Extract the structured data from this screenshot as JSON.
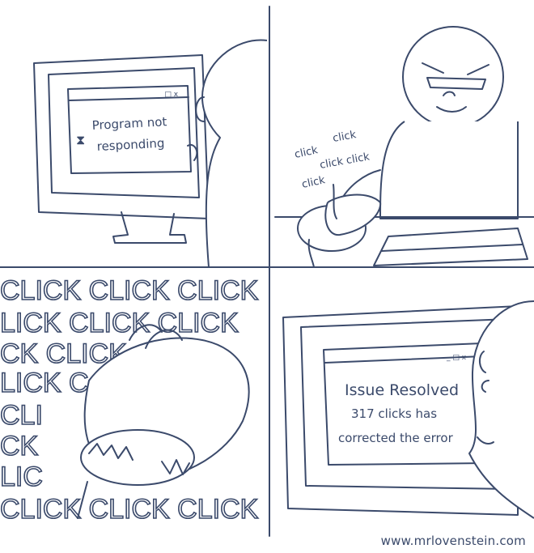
{
  "panel1": {
    "dialog_controls": "_ □ x",
    "hourglass": "⧗",
    "message_line1": "Program not",
    "message_line2": "responding"
  },
  "panel2": {
    "clicks": [
      "click",
      "click",
      "click",
      "click click",
      "click"
    ]
  },
  "panel3": {
    "click_rows": [
      "CLICK CLICK CLICK",
      "LICK CLICK CLICK",
      "CK CLICK",
      "LICK C",
      "CLI",
      "CK",
      "LIC",
      "CLICK CLICK CLICK"
    ]
  },
  "panel4": {
    "dialog_controls": "_ □ x",
    "title": "Issue Resolved",
    "line2": "317 clicks has",
    "line3": "corrected the error"
  },
  "credit": "www.mrlovenstein.com"
}
